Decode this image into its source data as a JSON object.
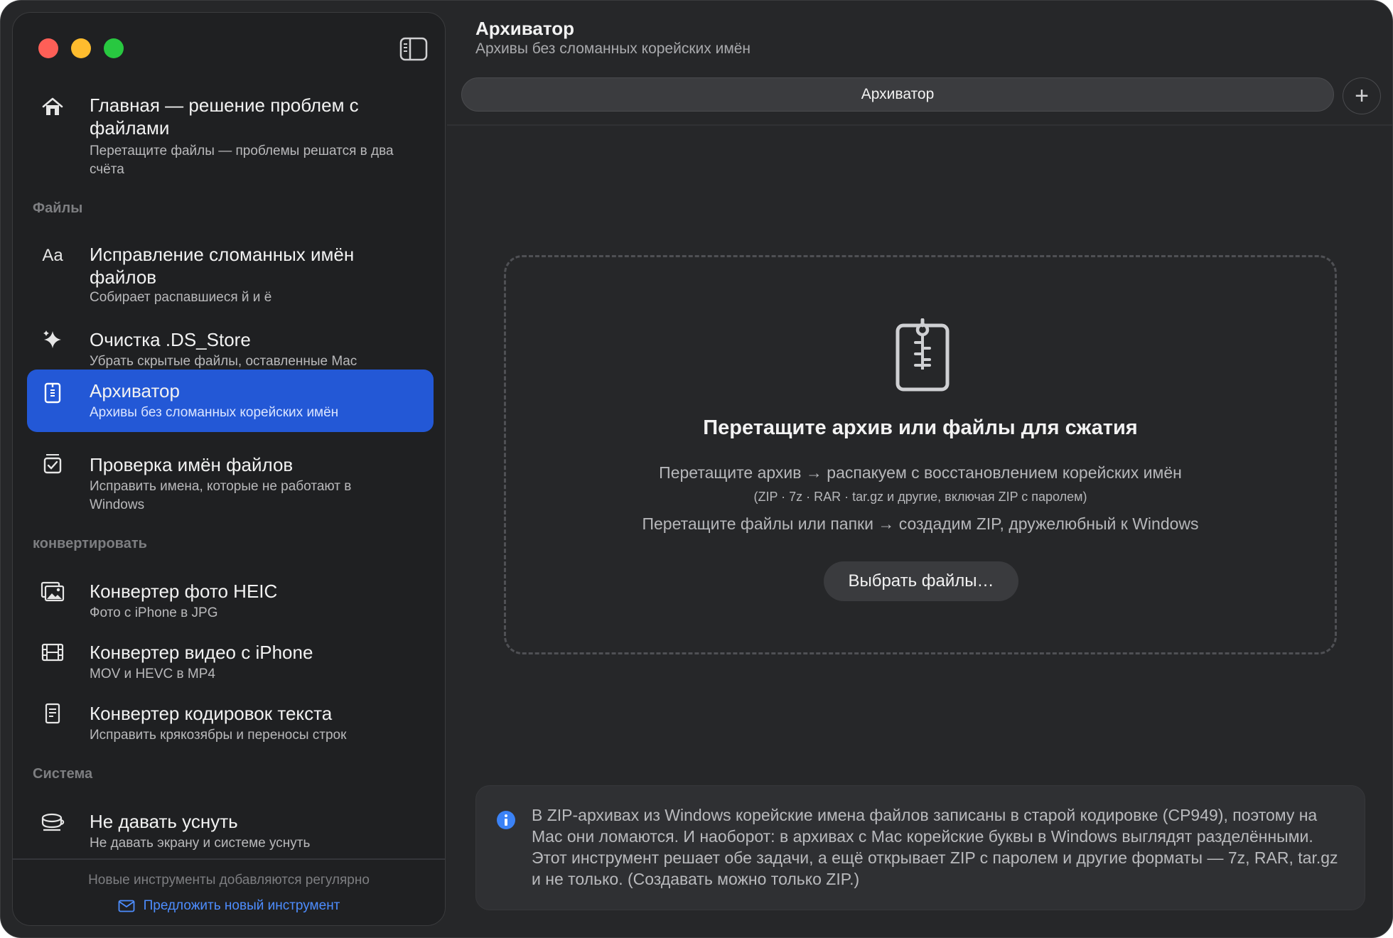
{
  "window": {
    "traffic_lights": {
      "close": "#fe5f57",
      "minimize": "#febc2e",
      "zoom": "#28c840"
    }
  },
  "sidebar": {
    "home": {
      "title": "Главная — решение проблем с файлами",
      "subtitle": "Перетащите файлы — проблемы решатся в два счёта",
      "icon": "house-icon"
    },
    "sections": [
      {
        "label": "Файлы"
      },
      {
        "label": "конвертировать"
      },
      {
        "label": "Система"
      }
    ],
    "items": [
      {
        "title": "Исправление сломанных имён файлов",
        "subtitle": "Собирает распавшиеся й и ё",
        "icon": "text-format-icon"
      },
      {
        "title": "Очистка .DS_Store",
        "subtitle": "Убрать скрытые файлы, оставленные Mac",
        "icon": "sparkles-icon"
      },
      {
        "title": "Архиватор",
        "subtitle": "Архивы без сломанных корейских имён",
        "icon": "archive-zipper-icon",
        "active": true
      },
      {
        "title": "Проверка имён файлов",
        "subtitle": "Исправить имена, которые не работают в Windows",
        "icon": "checkbox-tray-icon"
      },
      {
        "title": "Конвертер фото HEIC",
        "subtitle": "Фото с iPhone в JPG",
        "icon": "photos-icon"
      },
      {
        "title": "Конвертер видео с iPhone",
        "subtitle": "MOV и HEVC в MP4",
        "icon": "film-icon"
      },
      {
        "title": "Конвертер кодировок текста",
        "subtitle": "Исправить крякозябры и переносы строк",
        "icon": "document-icon"
      },
      {
        "title": "Не давать уснуть",
        "subtitle": "Не давать экрану и системе уснуть",
        "icon": "coffee-cup-icon"
      }
    ],
    "footer": {
      "note": "Новые инструменты добавляются регулярно",
      "link": "Предложить новый инструмент"
    }
  },
  "main": {
    "title": "Архиватор",
    "subtitle": "Архивы без сломанных корейских имён",
    "tab_label": "Архиватор",
    "dropzone": {
      "heading": "Перетащите архив или файлы для сжатия",
      "line1": "Перетащите архив → распакуем с восстановлением корейских имён",
      "line2": "(ZIP · 7z · RAR · tar.gz и другие, включая ZIP с паролем)",
      "line3": "Перетащите файлы или папки → создадим ZIP, дружелюбный к Windows",
      "button": "Выбрать файлы…"
    },
    "info": {
      "text": "В ZIP-архивах из Windows корейские имена файлов записаны в старой кодировке (CP949), поэтому на Mac они ломаются. И наоборот: в архивах с Mac корейские буквы в Windows выглядят разделёнными. Этот инструмент решает обе задачи, а ещё открывает ZIP с паролем и другие форматы — 7z, RAR, tar.gz и не только. (Создавать можно только ZIP.)"
    }
  },
  "colors": {
    "accent": "#2358d6",
    "link": "#4d8dff",
    "info_icon": "#3b82f6"
  }
}
